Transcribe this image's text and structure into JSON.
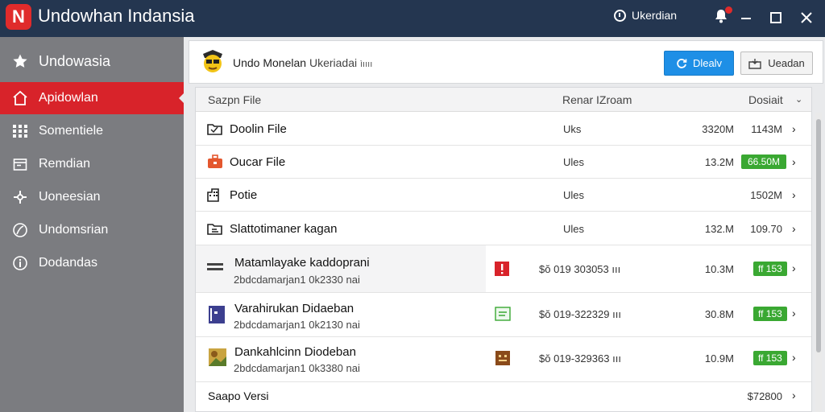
{
  "app": {
    "logo_letter": "N",
    "title": "Undowhan Indansia",
    "user_label": "Ukerdian",
    "brand_color": "#d8232a",
    "titlebar_color": "#243650"
  },
  "window_controls": {
    "minimize_icon": "minimize-icon",
    "maximize_icon": "maximize-icon",
    "close_icon": "close-icon"
  },
  "sidebar": {
    "items": [
      {
        "label": "Undowasia",
        "icon": "star-icon"
      },
      {
        "label": "Apidowlan",
        "icon": "home-icon",
        "active": true
      },
      {
        "label": "Somentiele",
        "icon": "grid-icon"
      },
      {
        "label": "Remdian",
        "icon": "calendar-icon"
      },
      {
        "label": "Uoneesian",
        "icon": "puzzle-icon"
      },
      {
        "label": "Undomsrian",
        "icon": "feather-icon"
      },
      {
        "label": "Dodandas",
        "icon": "info-icon"
      }
    ]
  },
  "header": {
    "title": "Undo Monelan",
    "title_light": "Ukeriadai",
    "title_suffix": "ìıııı",
    "primary_button": "Dlealv",
    "secondary_button": "Ueadan"
  },
  "list": {
    "columns": {
      "name": "Sazpn File",
      "mid": "Renar IZroam",
      "right": "Dosiait"
    },
    "rows": [
      {
        "name": "Doolin File",
        "type": "Uks",
        "size": "3320M",
        "date": "1143M",
        "icon": "folder-icon"
      },
      {
        "name": "Oucar File",
        "type": "Ules",
        "size": "13.2M",
        "date": "66.50M",
        "date_tag": true,
        "icon": "briefcase-icon"
      },
      {
        "name": "Potie",
        "type": "Ules",
        "size": "",
        "date": "1502M",
        "icon": "building-icon"
      },
      {
        "name": "Slattotimaner kagan",
        "type": "Ules",
        "size": "132.M",
        "date": "109.70",
        "icon": "folder-open-icon"
      },
      {
        "name": "Matamlayake kaddoprani",
        "sub": "2bdcdamarjan1 0k2330 nai",
        "code": "$ŏ 019 303053",
        "code_suffix": "ııı",
        "size": "10.3M",
        "tag": "ff 153",
        "icon": "list-icon",
        "type_icon": "alert-icon",
        "shaded": true
      },
      {
        "name": "Varahirukan Didaeban",
        "sub": "2bdcdamarjan1 0k2130 nai",
        "code": "$ŏ 019-322329",
        "code_suffix": "ııı",
        "size": "30.8M",
        "tag": "ff 153",
        "icon": "document-icon",
        "type_icon": "note-icon"
      },
      {
        "name": "Dankahlcinn Diodeban",
        "sub": "2bdcdamarjan1 0k3380 nai",
        "code": "$ŏ 019-329363",
        "code_suffix": "ııı",
        "size": "10.9M",
        "tag": "ff 153",
        "icon": "image-icon",
        "type_icon": "face-icon"
      },
      {
        "name": "Saapo Versi",
        "type": "",
        "size": "",
        "date": "$72800",
        "icon": ""
      }
    ]
  }
}
